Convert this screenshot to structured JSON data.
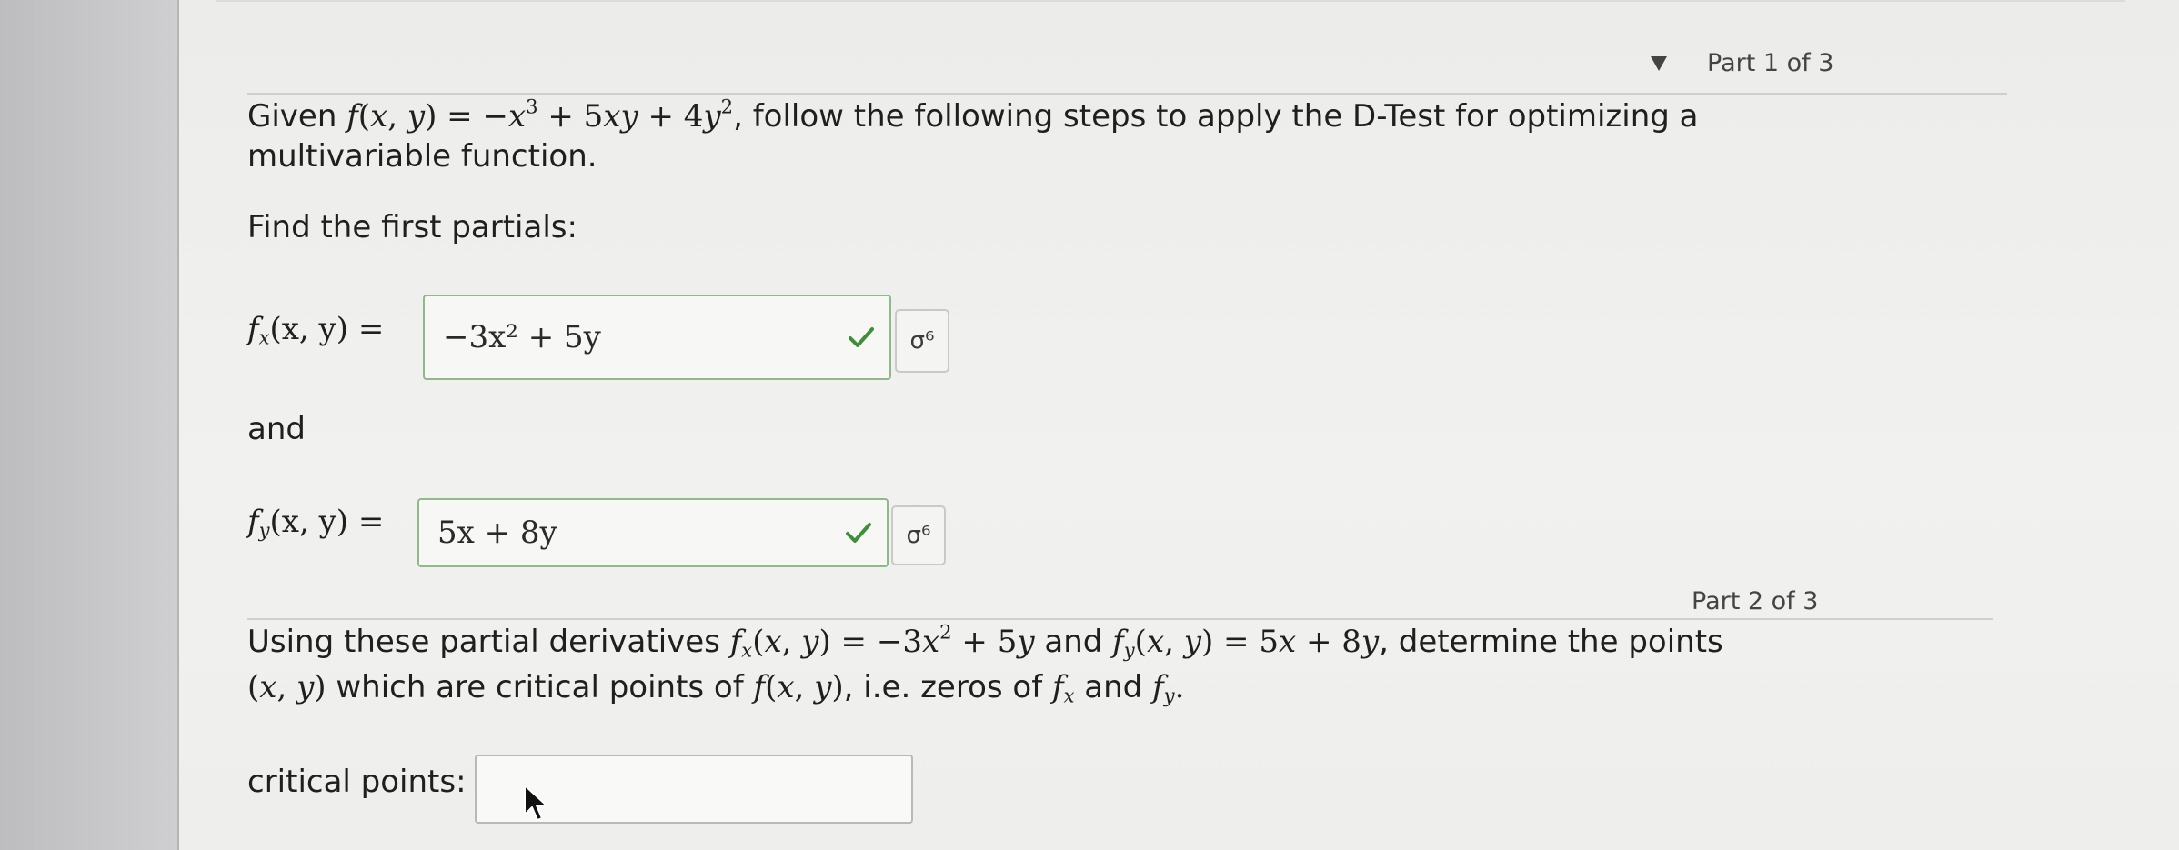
{
  "part1": {
    "label": "Part 1 of 3",
    "intro_prefix": "Given ",
    "intro_suffix": ", follow the following steps to apply the D-Test for optimizing a",
    "intro_line2": "multivariable function.",
    "find_prompt": "Find the first partials:",
    "fx_label": "f",
    "fx_sub": "x",
    "fx_args": "(x, y) =",
    "fx_answer": "−3x² + 5y",
    "and_text": "and",
    "fy_label": "f",
    "fy_sub": "y",
    "fy_args": "(x, y) =",
    "fy_answer": "5x + 8y",
    "tool_icon_glyph": "σ⁶"
  },
  "part2": {
    "label": "Part 2 of 3",
    "line1_prefix": "Using these partial derivatives ",
    "line1_mid": " and ",
    "line1_suffix": ", determine the points",
    "line2_mid": " which are critical points of ",
    "line2_mid2": ", i.e. zeros of ",
    "line2_and": " and ",
    "critical_label": "critical points:",
    "critical_value": ""
  },
  "colors": {
    "check": "#3f8f3a",
    "answer_border": "#8fb98a"
  }
}
